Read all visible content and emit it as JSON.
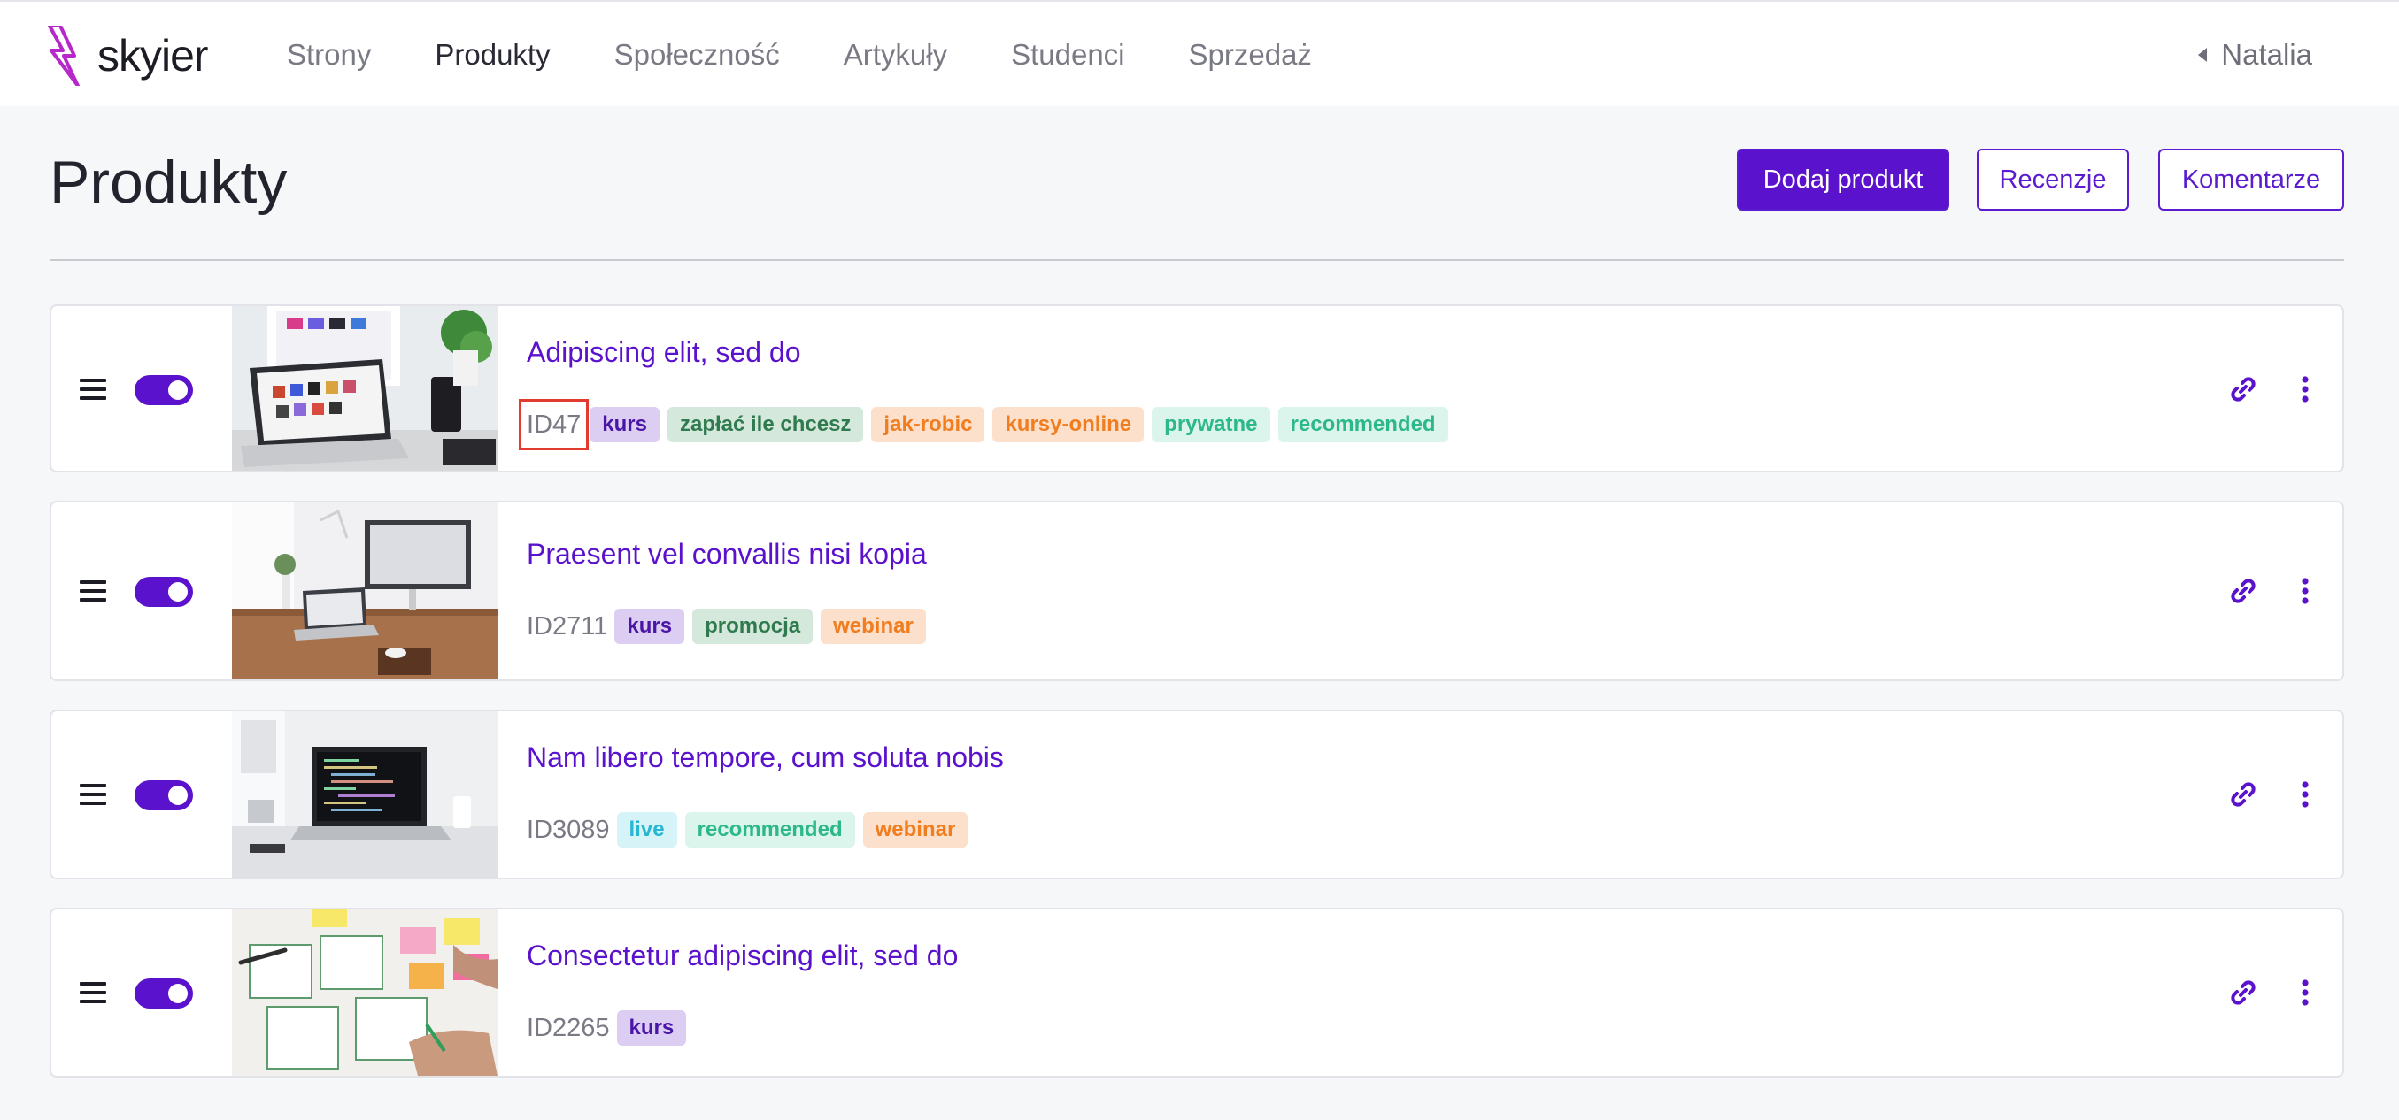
{
  "app": {
    "brand": "skyier",
    "brand_color": "#5b12cc"
  },
  "nav": {
    "items": [
      {
        "label": "Strony",
        "active": false
      },
      {
        "label": "Produkty",
        "active": true
      },
      {
        "label": "Społeczność",
        "active": false
      },
      {
        "label": "Artykuły",
        "active": false
      },
      {
        "label": "Studenci",
        "active": false
      },
      {
        "label": "Sprzedaż",
        "active": false
      }
    ],
    "user_name": "Natalia"
  },
  "header": {
    "title": "Produkty",
    "add_product_label": "Dodaj produkt",
    "reviews_label": "Recenzje",
    "comments_label": "Komentarze"
  },
  "products": [
    {
      "title": "Adipiscing elit, sed do",
      "id": "ID47",
      "enabled": true,
      "image": "laptop-desk-photo",
      "tags": [
        {
          "label": "kurs",
          "style": "purple"
        },
        {
          "label": "zapłać ile chcesz",
          "style": "green"
        },
        {
          "label": "jak-robic",
          "style": "orange"
        },
        {
          "label": "kursy-online",
          "style": "orange"
        },
        {
          "label": "prywatne",
          "style": "mint"
        },
        {
          "label": "recommended",
          "style": "mint"
        }
      ]
    },
    {
      "title": "Praesent vel convallis nisi kopia",
      "id": "ID2711",
      "enabled": true,
      "image": "workspace-photo",
      "tags": [
        {
          "label": "kurs",
          "style": "purple"
        },
        {
          "label": "promocja",
          "style": "green"
        },
        {
          "label": "webinar",
          "style": "orange"
        }
      ]
    },
    {
      "title": "Nam libero tempore, cum soluta nobis",
      "id": "ID3089",
      "enabled": true,
      "image": "code-laptop-photo",
      "tags": [
        {
          "label": "live",
          "style": "cyan"
        },
        {
          "label": "recommended",
          "style": "mint"
        },
        {
          "label": "webinar",
          "style": "orange"
        }
      ]
    },
    {
      "title": "Consectetur adipiscing elit, sed do",
      "id": "ID2265",
      "enabled": true,
      "image": "wireframe-sketch-photo",
      "tags": [
        {
          "label": "kurs",
          "style": "purple"
        }
      ]
    }
  ],
  "icons": {
    "drag": "drag-handle-icon",
    "toggle": "toggle-switch",
    "link": "link-icon",
    "more": "more-vertical-icon"
  }
}
